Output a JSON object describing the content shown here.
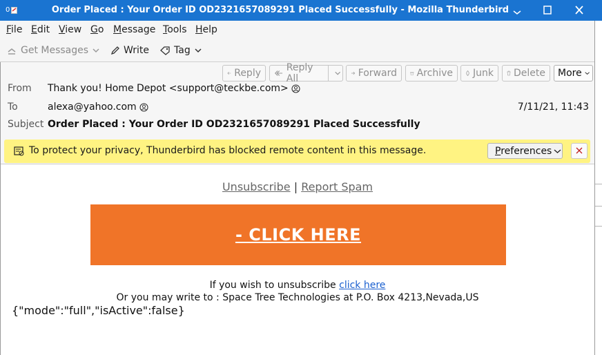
{
  "window": {
    "app_icon_label": "0",
    "title": "Order Placed : Your Order ID OD2321657089291 Placed Successfully - Mozilla Thunderbird"
  },
  "menu": [
    {
      "label": "File",
      "accel": "F",
      "rest": "ile"
    },
    {
      "label": "Edit",
      "accel": "E",
      "rest": "dit"
    },
    {
      "label": "View",
      "accel": "V",
      "rest": "iew"
    },
    {
      "label": "Go",
      "accel": "G",
      "rest": "o"
    },
    {
      "label": "Message",
      "accel": "M",
      "rest": "essage"
    },
    {
      "label": "Tools",
      "accel": "T",
      "rest": "ools"
    },
    {
      "label": "Help",
      "accel": "H",
      "rest": "elp"
    }
  ],
  "toolbar": {
    "get_messages": "Get Messages",
    "write": "Write",
    "tag": "Tag"
  },
  "header_buttons": {
    "reply": "Reply",
    "reply_all": "Reply All",
    "forward": "Forward",
    "archive": "Archive",
    "junk": "Junk",
    "delete": "Delete",
    "more": "More"
  },
  "message": {
    "from_label": "From",
    "from_value": "Thank you! Home Depot <support@teckbe.com>",
    "to_label": "To",
    "to_value": "alexa@yahoo.com",
    "date": "7/11/21, 11:43",
    "subject_label": "Subject",
    "subject_value": "Order Placed : Your Order ID OD2321657089291 Placed Successfully"
  },
  "notice": {
    "text": "To protect your privacy, Thunderbird has blocked remote content in this message.",
    "preferences": "Preferences",
    "preferences_accel": "P",
    "preferences_rest": "references"
  },
  "body": {
    "unsubscribe": "Unsubscribe",
    "separator": "|",
    "report_spam": "Report Spam",
    "cta": "- CLICK HERE",
    "unsub_prefix": "If you wish to unsubscribe",
    "unsub_link": "click here",
    "write_to": "Or you may write to : Space Tree Technologies at P.O. Box 4213,Nevada,US",
    "json_text": "{\"mode\":\"full\",\"isActive\":false}"
  },
  "colors": {
    "titlebar": "#1a74d1",
    "notice_bg": "#fff382",
    "cta_bg": "#f07428",
    "link_blue": "#1a5fcf"
  },
  "icons": [
    "thunderbird-app-icon",
    "minimize-icon",
    "maximize-icon",
    "close-icon",
    "download-icon",
    "chevron-down-icon",
    "pencil-icon",
    "tag-icon",
    "reply-icon",
    "reply-all-icon",
    "forward-icon",
    "archive-icon",
    "junk-icon",
    "trash-icon",
    "contact-icon",
    "blocked-content-icon"
  ]
}
